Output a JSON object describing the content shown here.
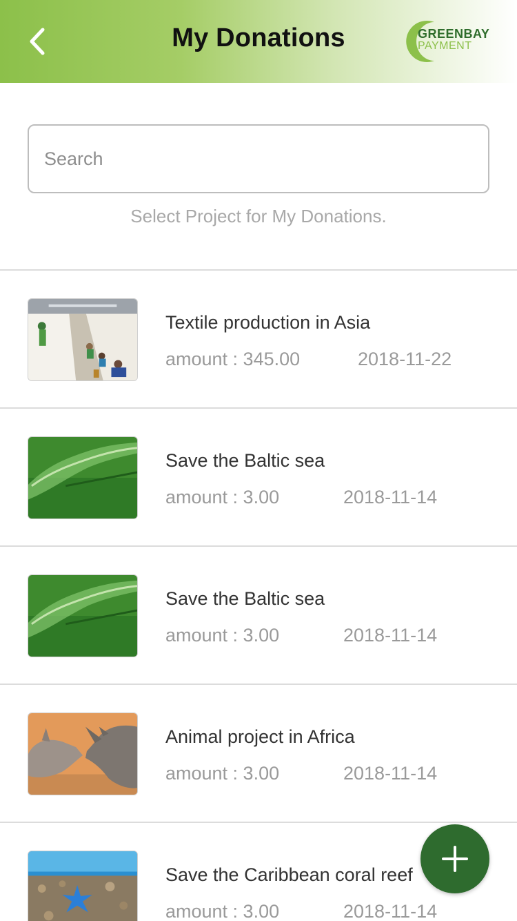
{
  "header": {
    "title": "My Donations",
    "back_icon": "chevron-left-icon",
    "logo": {
      "line1": "GREENBAY",
      "line2": "PAYMENT"
    }
  },
  "search": {
    "placeholder": "Search",
    "value": ""
  },
  "hint": "Select Project for My Donations.",
  "donations": [
    {
      "title": "Textile production in Asia",
      "amount": "amount : 345.00",
      "date": "2018-11-22",
      "image": "textile-factory-photo"
    },
    {
      "title": "Save the Baltic sea",
      "amount": "amount : 3.00",
      "date": "2018-11-14",
      "image": "green-sea-photo"
    },
    {
      "title": "Save the Baltic sea",
      "amount": "amount : 3.00",
      "date": "2018-11-14",
      "image": "green-sea-photo"
    },
    {
      "title": "Animal project in Africa",
      "amount": "amount : 3.00",
      "date": "2018-11-14",
      "image": "rhinos-photo"
    },
    {
      "title": "Save the Caribbean coral reef",
      "amount": "amount : 3.00",
      "date": "2018-11-14",
      "image": "coral-starfish-photo"
    }
  ],
  "fab": {
    "icon": "plus-icon"
  },
  "colors": {
    "header_start": "#8cc04a",
    "brand_dark_green": "#2e6b2e",
    "fab": "#2e6b2e"
  }
}
